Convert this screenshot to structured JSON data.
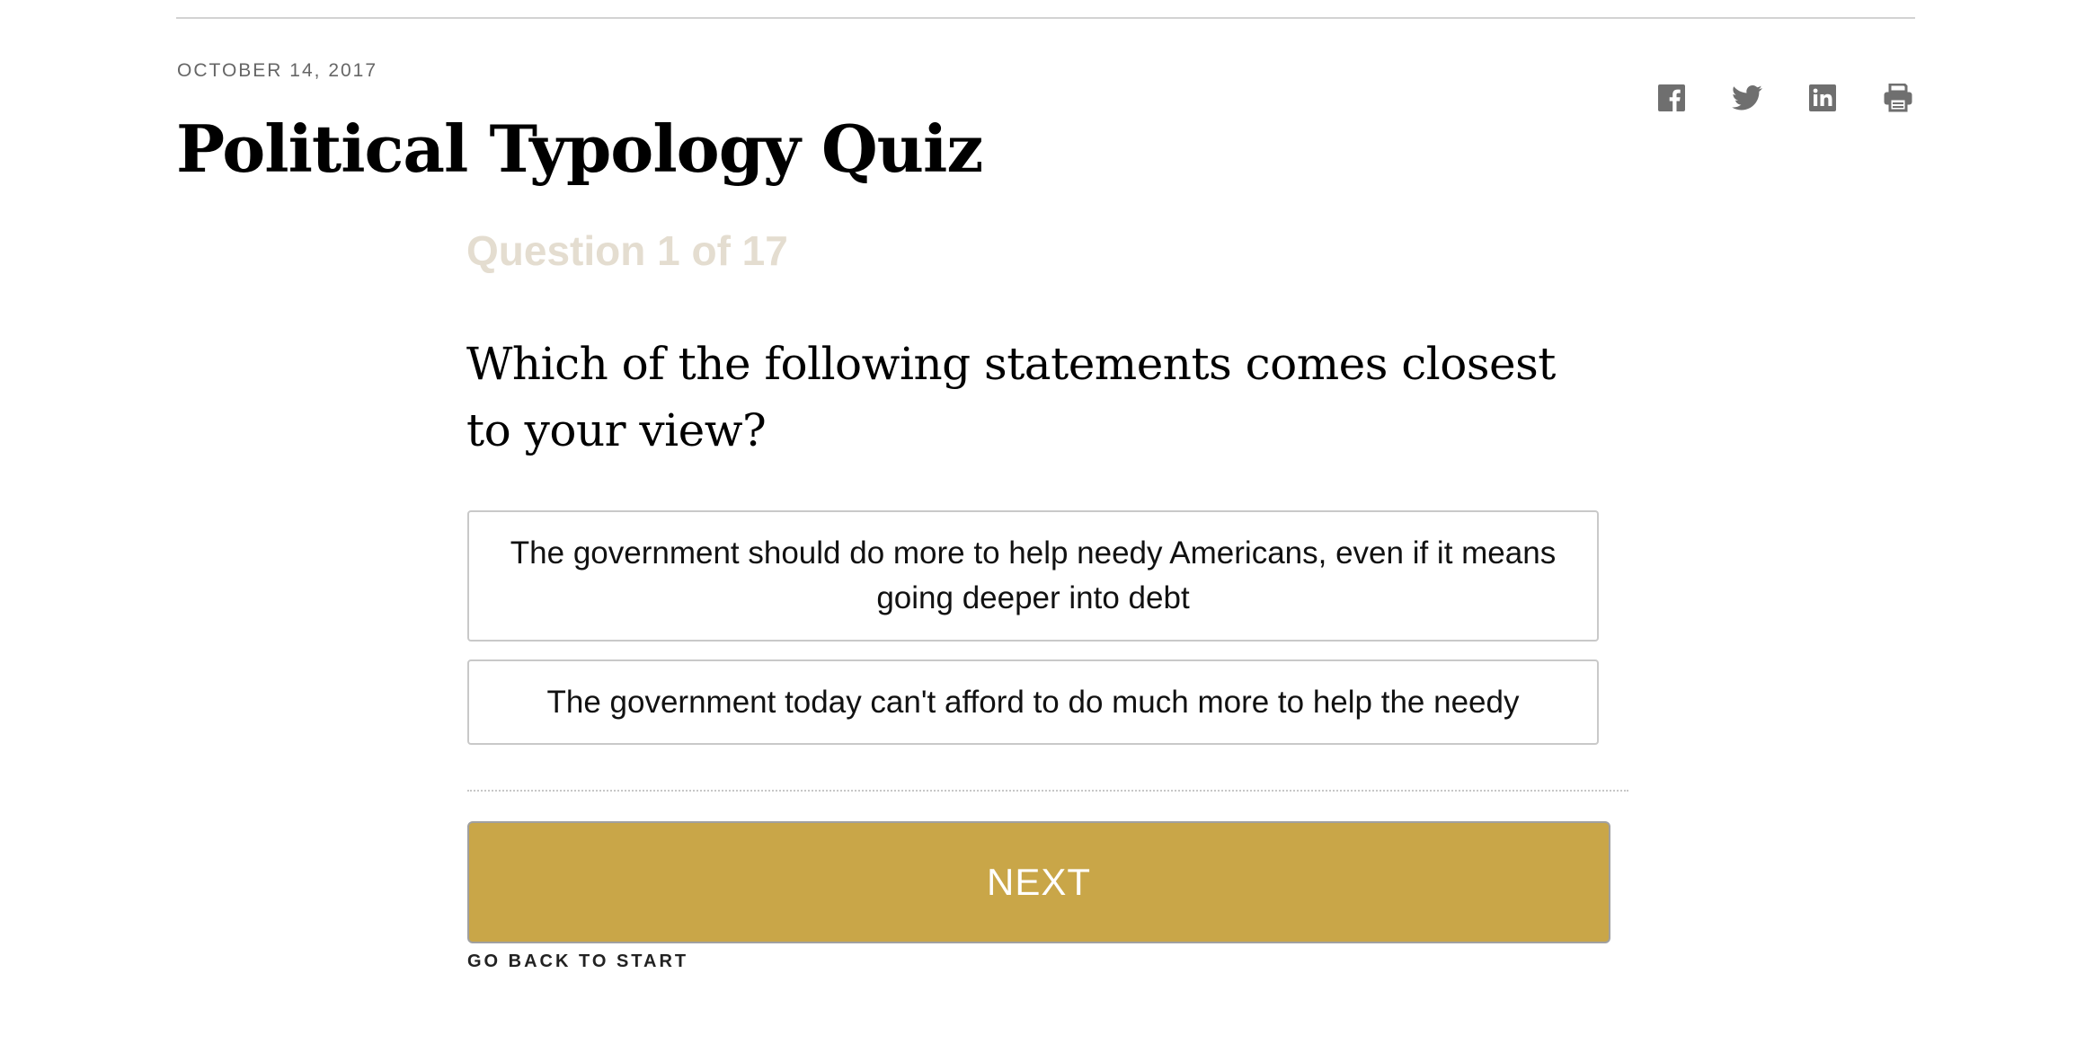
{
  "article": {
    "date": "OCTOBER 14, 2017",
    "title": "Political Typology Quiz"
  },
  "share": {
    "icons": [
      "facebook-icon",
      "twitter-icon",
      "linkedin-icon",
      "print-icon"
    ],
    "icon_color": "#6f6f6f"
  },
  "quiz": {
    "counter": "Question 1 of 17",
    "question": "Which of the following statements comes closest to your view?",
    "answers": [
      "The government should do more to help needy Americans, even if it means going deeper into debt",
      "The government today can't afford to do much more to help the needy"
    ],
    "next_label": "NEXT",
    "back_label": "GO BACK TO START"
  },
  "colors": {
    "next_button": "#c9a648",
    "counter_text": "#e4ddd0"
  }
}
